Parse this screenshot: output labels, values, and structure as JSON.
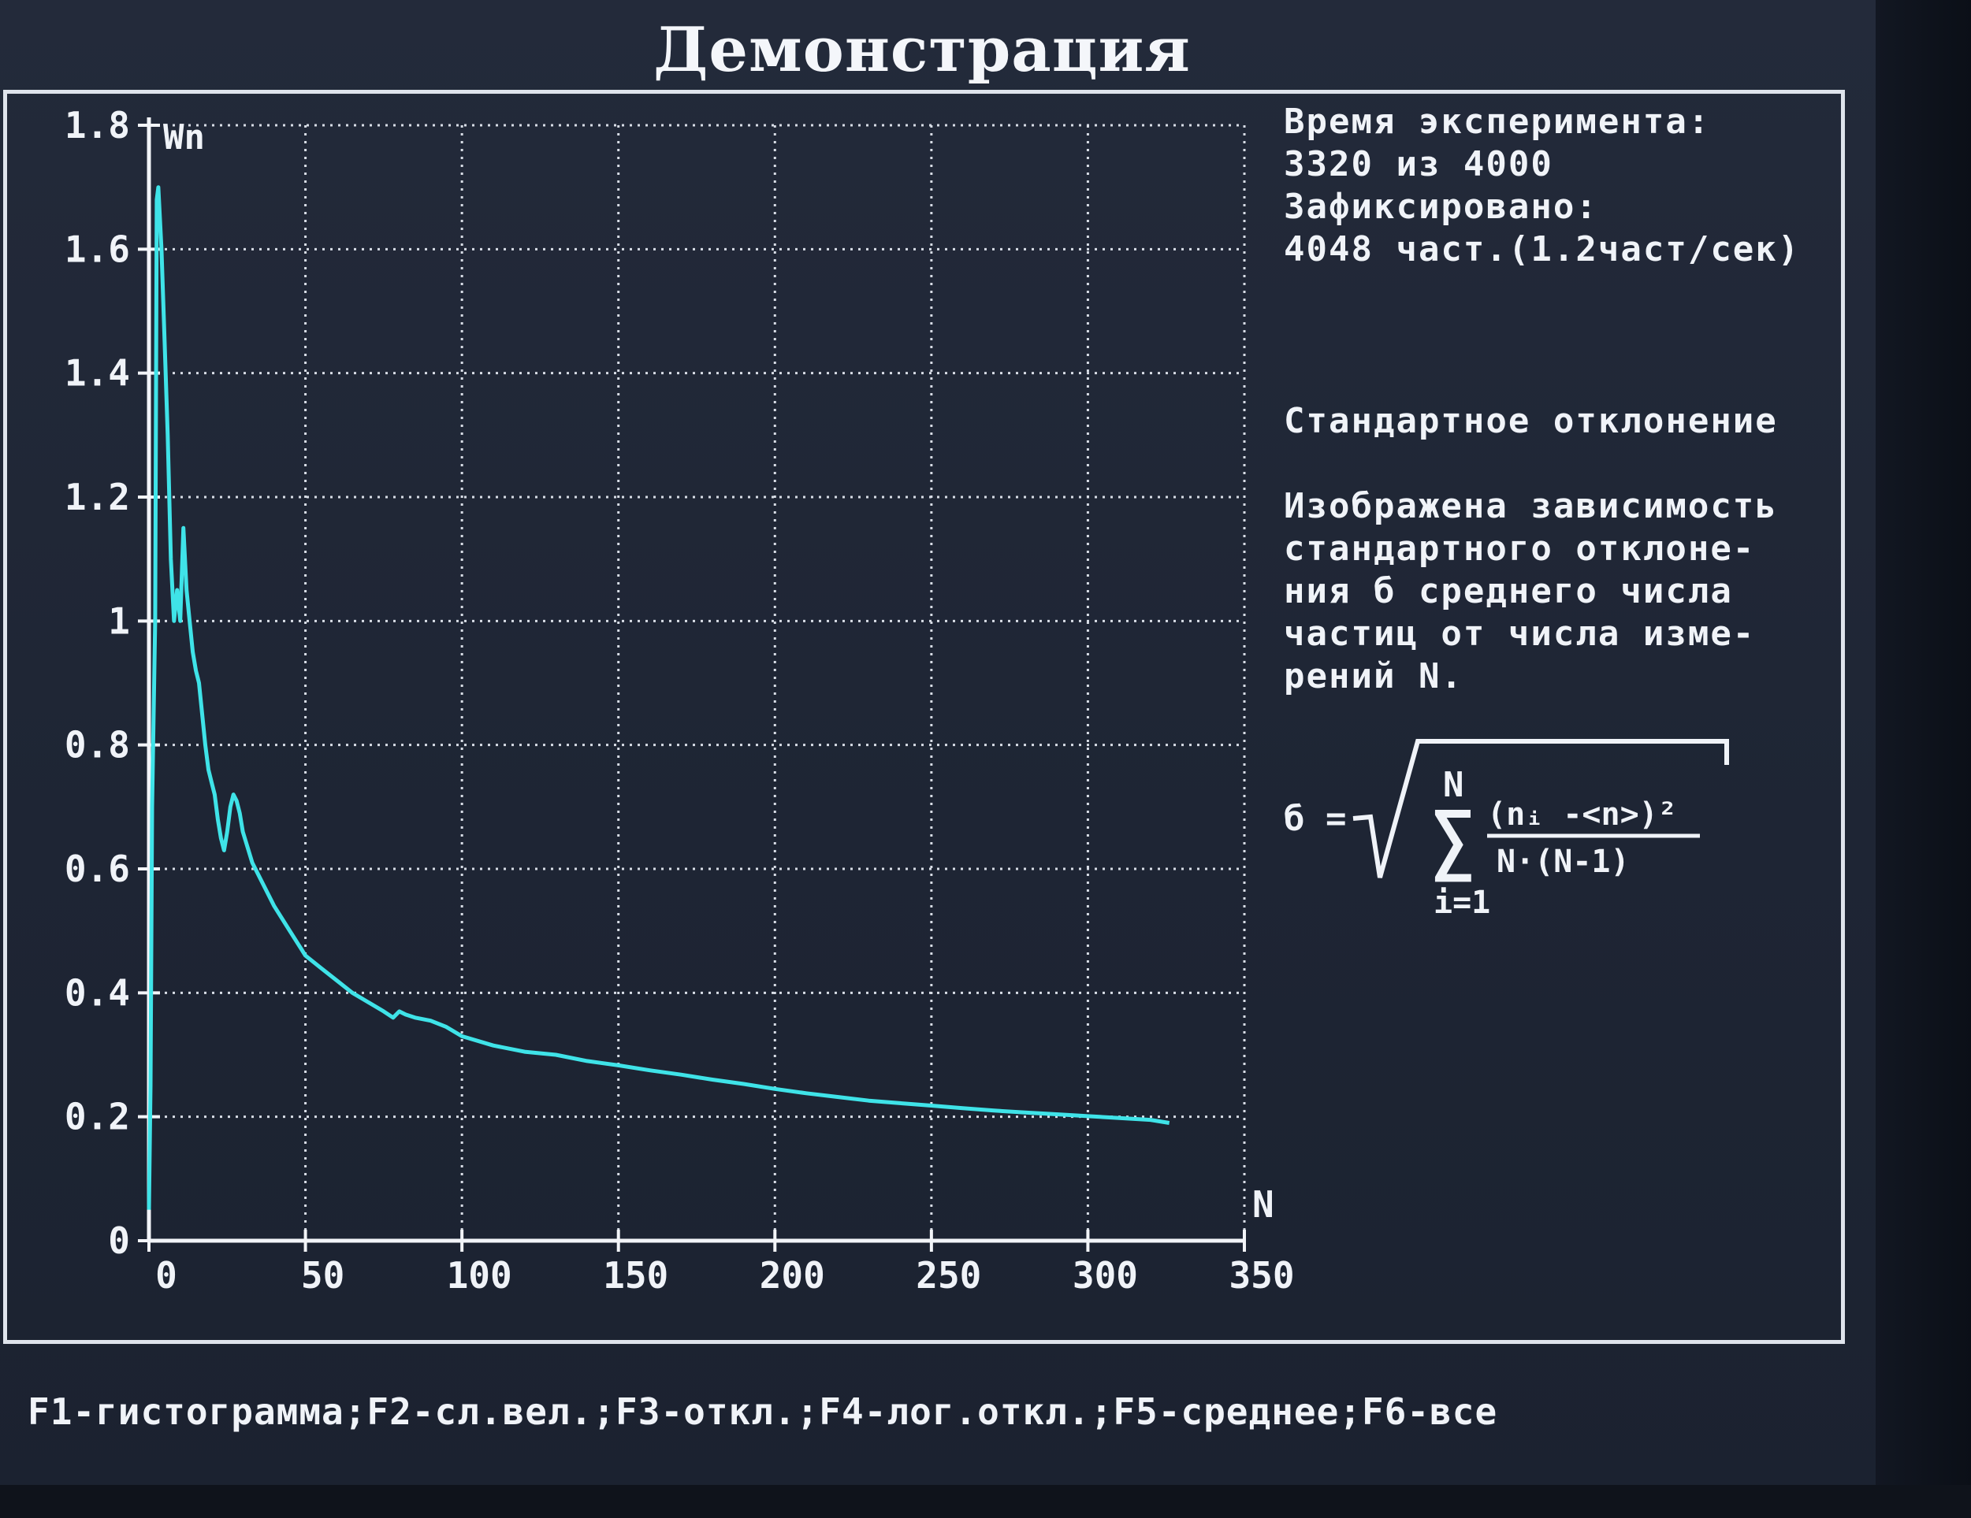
{
  "app": {
    "title": "Демонстрация"
  },
  "info": {
    "time_label": "Время эксперимента:",
    "time_value": "3320 из 4000",
    "fixed_label": "Зафиксировано:",
    "fixed_value": "4048 част.(1.2част/сек)",
    "mode_title": "Стандартное отклонение",
    "description": [
      "Изображена зависимость",
      "стандартного отклоне-",
      "ния б среднего числа",
      "частиц от числа изме-",
      "рений N."
    ]
  },
  "formula": {
    "lhs": "б =",
    "upper": "N",
    "lower": "i=1",
    "sum_symbol": "∑",
    "numerator": "(nᵢ -<n>)²",
    "denominator": "N·(N-1)"
  },
  "footer": {
    "keys": "F1-гистограмма;F2-сл.вел.;F3-откл.;F4-лог.откл.;F5-среднее;F6-все"
  },
  "colors": {
    "line": "#3fe3e8",
    "grid": "#d8dde6",
    "axis": "#f2f4f8"
  },
  "chart_data": {
    "type": "line",
    "ylabel": "Wn",
    "xlabel": "N",
    "xlim": [
      0,
      350
    ],
    "ylim": [
      0,
      1.8
    ],
    "x_ticks": [
      "0",
      "50",
      "100",
      "150",
      "200",
      "250",
      "300",
      "350"
    ],
    "y_ticks": [
      "0",
      "0.2",
      "0.4",
      "0.6",
      "0.8",
      "1",
      "1.2",
      "1.4",
      "1.6",
      "1.8"
    ],
    "grid": true,
    "series": [
      {
        "points": [
          [
            0,
            0.05
          ],
          [
            0.5,
            0.25
          ],
          [
            1,
            0.7
          ],
          [
            2,
            1.0
          ],
          [
            2.5,
            1.68
          ],
          [
            3,
            1.7
          ],
          [
            4,
            1.6
          ],
          [
            5,
            1.45
          ],
          [
            6,
            1.3
          ],
          [
            7,
            1.1
          ],
          [
            8,
            1.0
          ],
          [
            9,
            1.05
          ],
          [
            10,
            1.0
          ],
          [
            11,
            1.15
          ],
          [
            12,
            1.05
          ],
          [
            13,
            1.0
          ],
          [
            14,
            0.95
          ],
          [
            15,
            0.92
          ],
          [
            16,
            0.9
          ],
          [
            17,
            0.85
          ],
          [
            18,
            0.8
          ],
          [
            19,
            0.76
          ],
          [
            20,
            0.74
          ],
          [
            21,
            0.72
          ],
          [
            22,
            0.68
          ],
          [
            23,
            0.65
          ],
          [
            24,
            0.63
          ],
          [
            25,
            0.66
          ],
          [
            26,
            0.7
          ],
          [
            27,
            0.72
          ],
          [
            28,
            0.71
          ],
          [
            29,
            0.69
          ],
          [
            30,
            0.66
          ],
          [
            33,
            0.61
          ],
          [
            36,
            0.58
          ],
          [
            40,
            0.54
          ],
          [
            45,
            0.5
          ],
          [
            50,
            0.46
          ],
          [
            55,
            0.44
          ],
          [
            60,
            0.42
          ],
          [
            65,
            0.4
          ],
          [
            70,
            0.385
          ],
          [
            75,
            0.37
          ],
          [
            78,
            0.36
          ],
          [
            80,
            0.37
          ],
          [
            82,
            0.365
          ],
          [
            85,
            0.36
          ],
          [
            90,
            0.355
          ],
          [
            95,
            0.345
          ],
          [
            100,
            0.33
          ],
          [
            110,
            0.315
          ],
          [
            120,
            0.305
          ],
          [
            130,
            0.3
          ],
          [
            140,
            0.29
          ],
          [
            150,
            0.283
          ],
          [
            160,
            0.275
          ],
          [
            170,
            0.268
          ],
          [
            180,
            0.26
          ],
          [
            190,
            0.253
          ],
          [
            200,
            0.245
          ],
          [
            210,
            0.238
          ],
          [
            220,
            0.232
          ],
          [
            230,
            0.226
          ],
          [
            240,
            0.222
          ],
          [
            250,
            0.218
          ],
          [
            260,
            0.214
          ],
          [
            270,
            0.21
          ],
          [
            280,
            0.207
          ],
          [
            290,
            0.204
          ],
          [
            300,
            0.201
          ],
          [
            310,
            0.198
          ],
          [
            320,
            0.195
          ],
          [
            326,
            0.19
          ]
        ]
      }
    ]
  }
}
